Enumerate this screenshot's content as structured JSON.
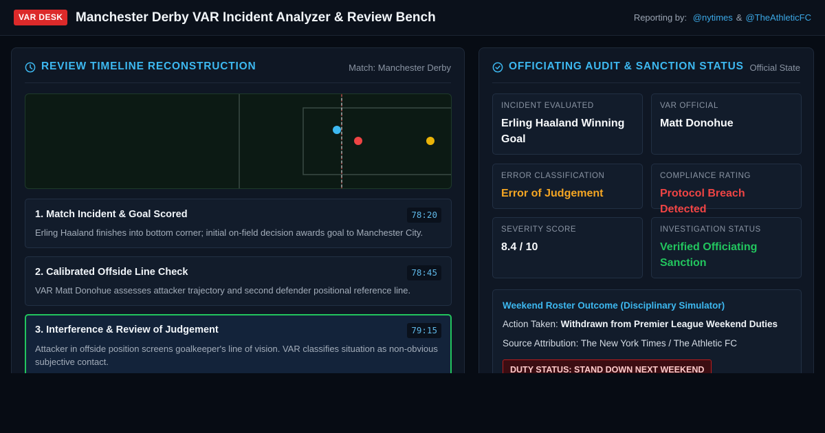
{
  "header": {
    "badge": "VAR DESK",
    "title": "Manchester Derby VAR Incident Analyzer & Review Bench",
    "reporting_label": "Reporting by:",
    "reporters": [
      "@nytimes",
      "@TheAthleticFC"
    ],
    "separator": "&"
  },
  "left_panel": {
    "title": "Review Timeline Reconstruction",
    "meta": "Match: Manchester Derby",
    "timeline": [
      {
        "title": "1. Match Incident & Goal Scored",
        "time": "78:20",
        "description": "Erling Haaland finishes into bottom corner; initial on-field decision awards goal to Manchester City."
      },
      {
        "title": "2. Calibrated Offside Line Check",
        "time": "78:45",
        "description": "VAR Matt Donohue assesses attacker trajectory and second defender positional reference line."
      },
      {
        "title": "3. Interference & Review of Judgement",
        "time": "79:15",
        "description": "Attacker in offside position screens goalkeeper's line of vision. VAR classifies situation as non-obvious subjective contact.",
        "active": true
      }
    ]
  },
  "right_panel": {
    "title": "Officiating Audit & Sanction Status",
    "meta": "Official State",
    "fields": {
      "incident_label": "Incident Evaluated",
      "incident_value": "Erling Haaland Winning Goal",
      "official_label": "VAR Official",
      "official_value": "Matt Donohue",
      "error_label": "Error Classification",
      "error_value": "Error of Judgement",
      "compliance_label": "Compliance Rating",
      "compliance_value": "Protocol Breach Detected",
      "severity_label": "Severity Score",
      "severity_value": "8.4 / 10",
      "investigation_label": "Investigation Status",
      "investigation_value": "Verified Officiating Sanction"
    },
    "outcome": {
      "title": "Weekend Roster Outcome (Disciplinary Simulator)",
      "action_label": "Action Taken:",
      "action_value": "Withdrawn from Premier League Weekend Duties",
      "source_label": "Source Attribution:",
      "source_value": "The New York Times / The Athletic FC",
      "duty_status": "DUTY STATUS: STAND DOWN NEXT WEEKEND"
    }
  },
  "colors": {
    "accent": "#3db8f0",
    "badge_red": "#dc2a2a",
    "warning_orange": "#f5a623",
    "breach_red": "#ef4444",
    "verified_green": "#22c55e",
    "attacker_dot": "#3db8f0",
    "defender_dot": "#ef4444",
    "goalkeeper_dot": "#eab308"
  }
}
